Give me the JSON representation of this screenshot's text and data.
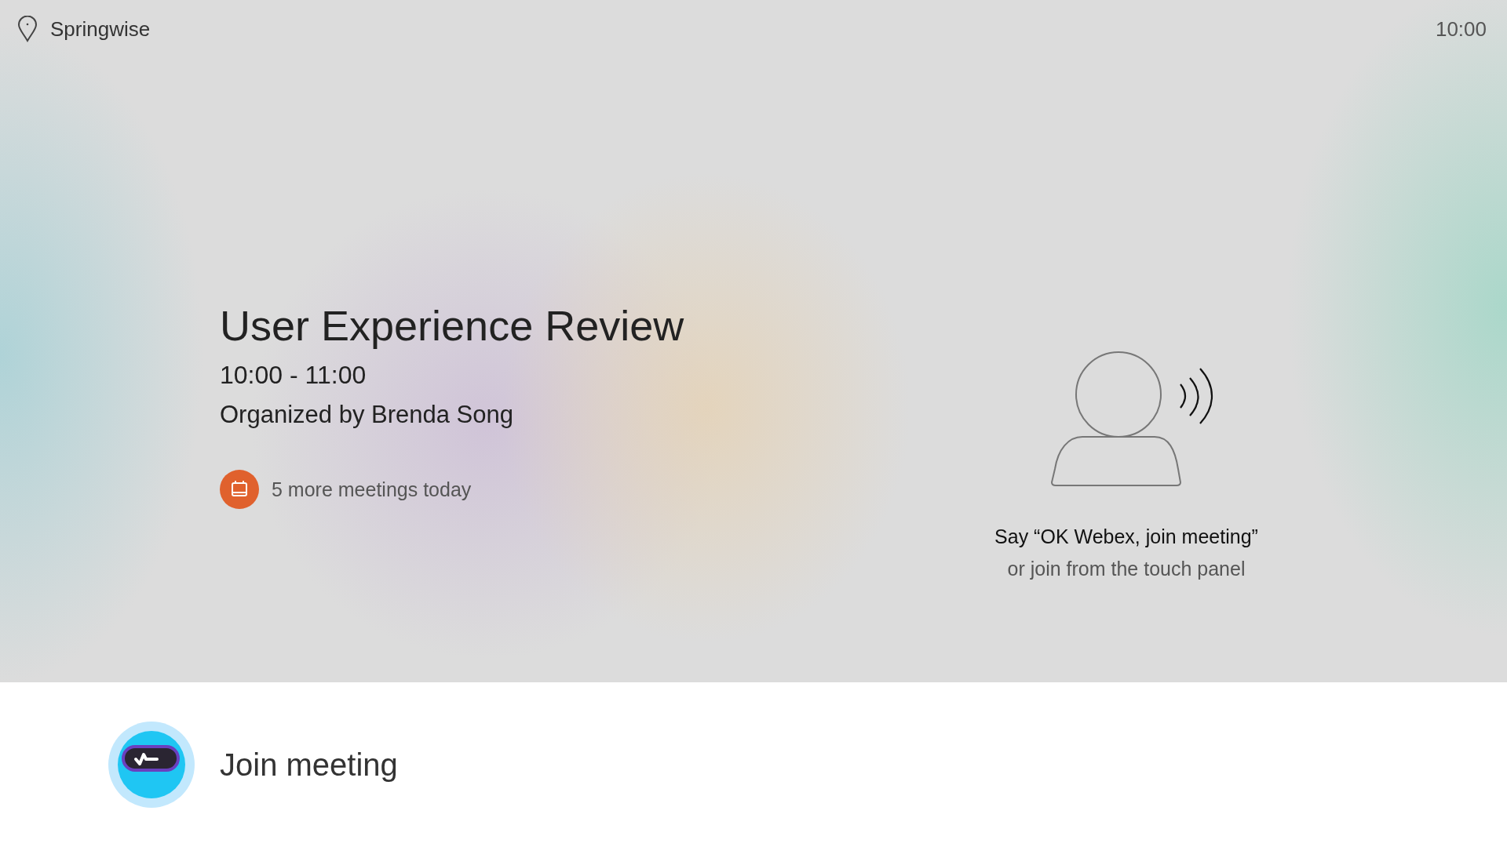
{
  "header": {
    "location": "Springwise",
    "clock": "10:00"
  },
  "meeting": {
    "title": "User Experience Review",
    "time": "10:00 - 11:00",
    "organizer": "Organized by Brenda Song",
    "more_meetings": "5 more meetings today"
  },
  "voice_prompt": {
    "line_1": "Say “OK Webex, join meeting”",
    "line_2": "or join from the touch panel"
  },
  "join_button": {
    "label": "Join meeting"
  }
}
